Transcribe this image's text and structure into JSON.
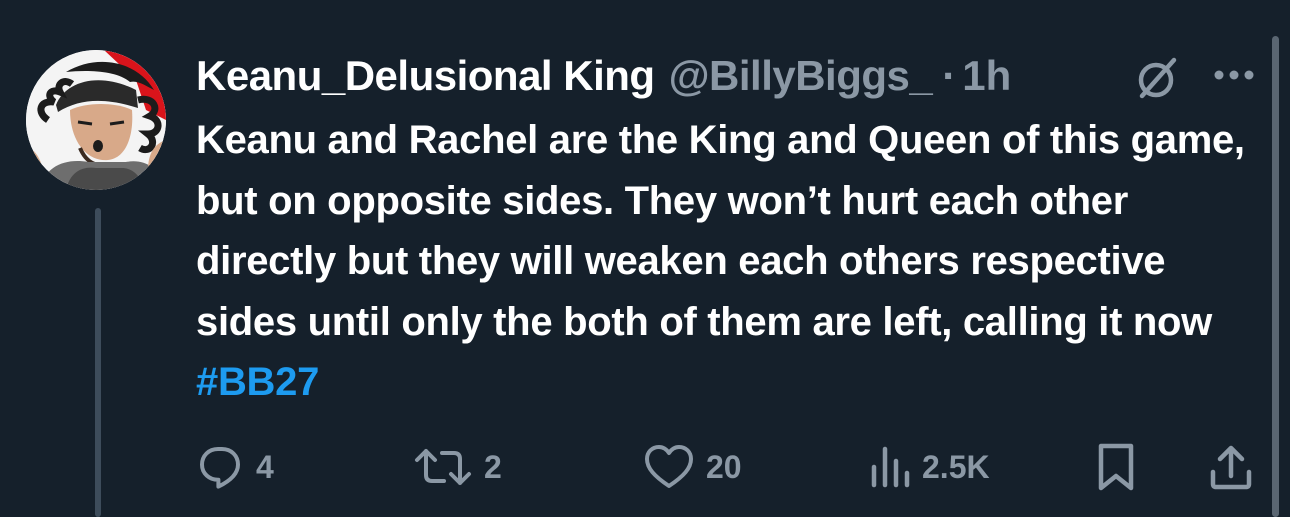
{
  "tweet": {
    "display_name": "Keanu_Delusional King",
    "handle": "@BillyBiggs_",
    "separator": "·",
    "time": "1h",
    "text": "Keanu and Rachel are the King and Queen of this game, but on opposite sides. They won’t hurt each other directly but they will weaken each others respective sides until only the both of them are left, calling it now ",
    "hashtag": "#BB27"
  },
  "actions": {
    "replies": "4",
    "retweets": "2",
    "likes": "20",
    "views": "2.5K"
  },
  "icons": {
    "header": [
      "grok-icon",
      "more-icon"
    ],
    "actions": [
      "reply-icon",
      "retweet-icon",
      "like-icon",
      "views-icon",
      "bookmark-icon",
      "share-icon"
    ]
  },
  "colors": {
    "background": "#15202b",
    "text": "#ffffff",
    "secondary_text": "#8b98a5",
    "accent": "#1d9bf0"
  }
}
